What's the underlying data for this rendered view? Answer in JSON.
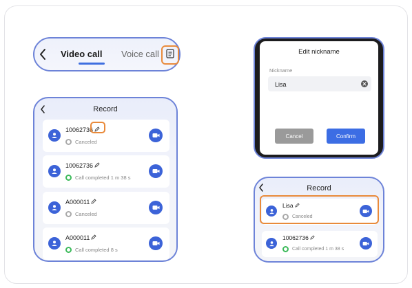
{
  "tabbar": {
    "active_tab": "Video call",
    "inactive_tab": "Voice call"
  },
  "record_left": {
    "title": "Record",
    "items": [
      {
        "name": "10062736",
        "status": "Canceled",
        "status_kind": "canceled"
      },
      {
        "name": "10062736",
        "status": "Call completed 1 m 38 s",
        "status_kind": "completed"
      },
      {
        "name": "A000011",
        "status": "Canceled",
        "status_kind": "canceled"
      },
      {
        "name": "A000011",
        "status": "Call completed 8 s",
        "status_kind": "completed"
      }
    ]
  },
  "dialog": {
    "title": "Edit nickname",
    "label": "Nickname",
    "value": "Lisa",
    "cancel_label": "Cancel",
    "confirm_label": "Confirm"
  },
  "record_right": {
    "title": "Record",
    "items": [
      {
        "name": "Lisa",
        "status": "Canceled",
        "status_kind": "canceled"
      },
      {
        "name": "10062736",
        "status": "Call completed 1 m 38 s",
        "status_kind": "completed"
      }
    ]
  },
  "colors": {
    "accent_blue": "#3c63d8",
    "frame_blue": "#6d83d8",
    "highlight_orange": "#e98a3a",
    "status_green": "#3cba5a"
  }
}
